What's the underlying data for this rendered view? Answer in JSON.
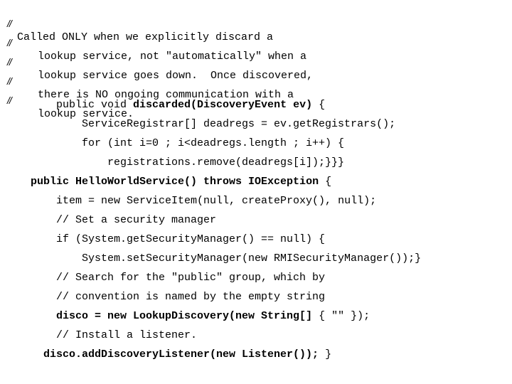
{
  "document": {
    "comment_prefix": "//",
    "lines": [
      {
        "kind": "comment",
        "text": "Called ONLY when we explicitly discard a"
      },
      {
        "kind": "comment",
        "text": "lookup service, not \"automatically\" when a"
      },
      {
        "kind": "comment",
        "text": "lookup service goes down.  Once discovered,"
      },
      {
        "kind": "comment",
        "text": "there is NO ongoing communication with a"
      },
      {
        "kind": "comment",
        "text": "lookup service."
      },
      {
        "kind": "code",
        "parts": [
          "public void ",
          "discarded(DiscoveryEvent ev)",
          " {"
        ]
      },
      {
        "kind": "code",
        "text": "ServiceRegistrar[] deadregs = ev.getRegistrars();"
      },
      {
        "kind": "code",
        "text": "for (int i=0 ; i<deadregs.length ; i++) {"
      },
      {
        "kind": "code",
        "text": "registrations.remove(deadregs[i]);}}}"
      },
      {
        "kind": "code",
        "parts": [
          "public HelloWorldService() throws IOException",
          " {"
        ]
      },
      {
        "kind": "code",
        "text": "item = new ServiceItem(null, createProxy(), null);"
      },
      {
        "kind": "code",
        "text": "// Set a security manager"
      },
      {
        "kind": "code",
        "text": "if (System.getSecurityManager() == null) {"
      },
      {
        "kind": "code",
        "text": "System.setSecurityManager(new RMISecurityManager());}"
      },
      {
        "kind": "code",
        "text": "// Search for the \"public\" group, which by"
      },
      {
        "kind": "code",
        "text": "// convention is named by the empty string"
      },
      {
        "kind": "code",
        "parts": [
          "disco = new LookupDiscovery(new String[]",
          " { \"\" });"
        ]
      },
      {
        "kind": "code",
        "text": "// Install a listener."
      },
      {
        "kind": "code",
        "parts": [
          "disco.addDiscoveryListener(new Listener());",
          " }"
        ]
      }
    ]
  }
}
